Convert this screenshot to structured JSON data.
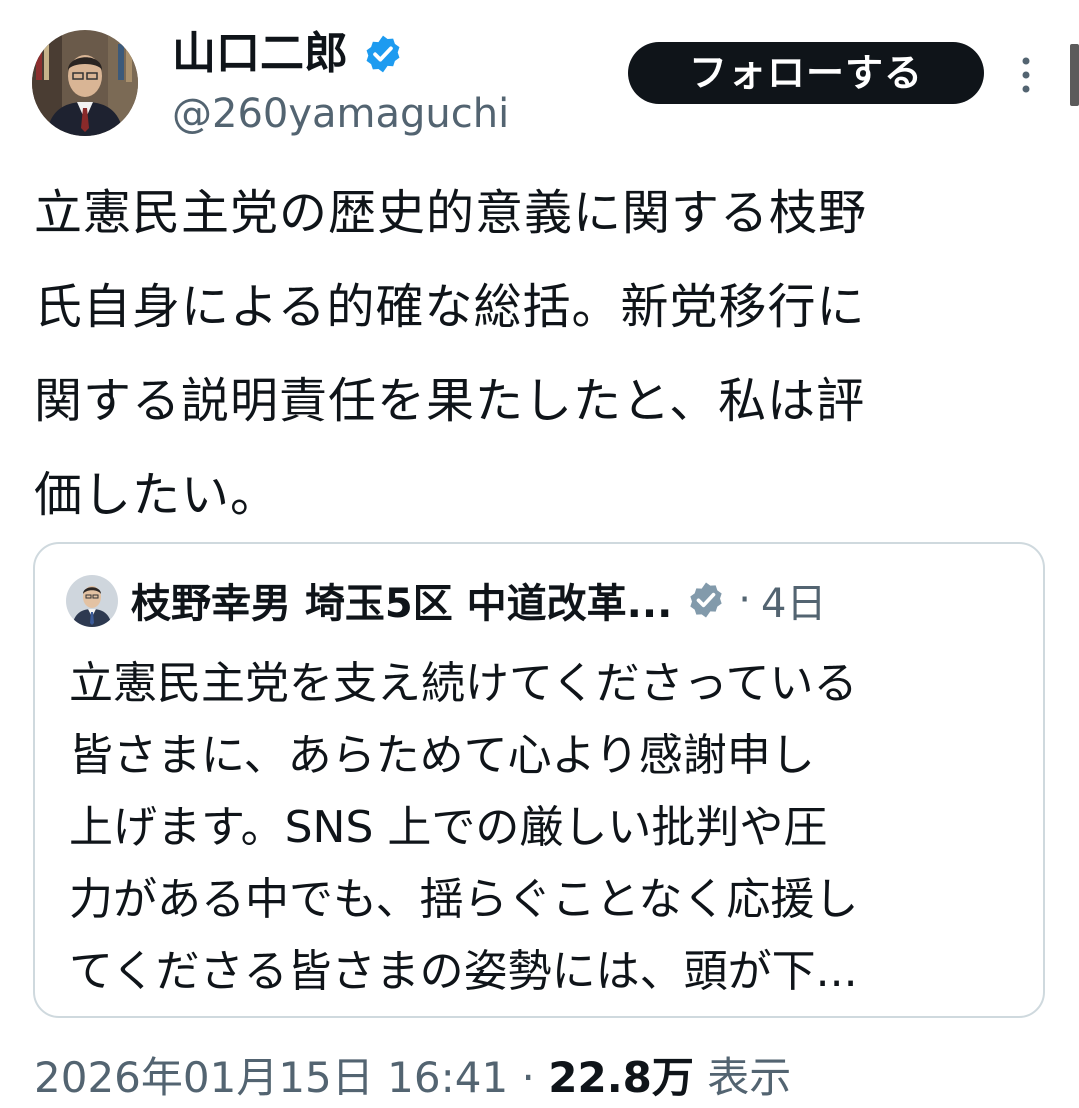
{
  "author": {
    "name": "山口二郎",
    "handle": "@260yamaguchi",
    "verified_color": "#1d9bf0"
  },
  "follow_button": {
    "label": "フォローする"
  },
  "more_menu": {
    "icon": "more-vertical-icon"
  },
  "tweet": {
    "text": "立憲民主党の歴史的意義に関する枝野\n氏自身による的確な総括。新党移行に\n関する説明責任を果たしたと、私は評\n価したい。"
  },
  "quote": {
    "author_name": "枝野幸男 埼玉5区 中道改革...",
    "verified_color": "#829aab",
    "separator": "·",
    "time": "4日",
    "text": "立憲民主党を支え続けてくださっている\n皆さまに、あらためて心より感謝申し\n上げます。SNS 上での厳しい批判や圧\n力がある中でも、揺らぐことなく応援し\nてくださる皆さまの姿勢には、頭が下..."
  },
  "meta": {
    "timestamp": "2026年01月15日 16:41",
    "separator": "·",
    "views_count": "22.8万",
    "views_label": "表示"
  }
}
